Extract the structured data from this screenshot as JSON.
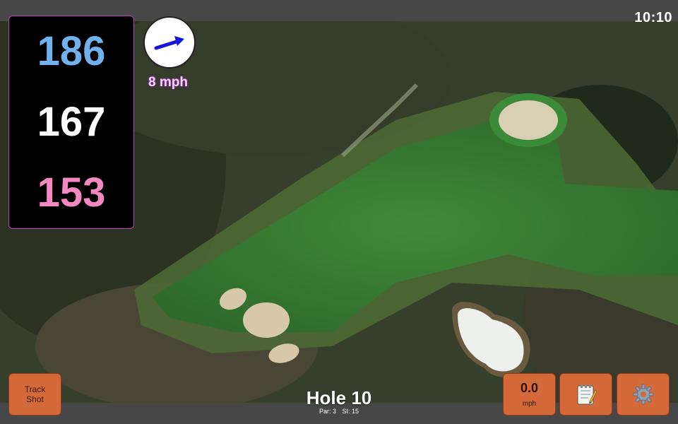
{
  "status": {
    "clock": "10:10"
  },
  "distances": {
    "back": "186",
    "middle": "167",
    "front": "153"
  },
  "wind": {
    "speed_label": "8 mph"
  },
  "buttons": {
    "track_shot_line1": "Track",
    "track_shot_line2": "Shot",
    "speed_value": "0.0",
    "speed_unit": "mph",
    "notes_icon": "notepad-icon",
    "settings_icon": "gear-icon"
  },
  "hole": {
    "title": "Hole 10",
    "par_label": "Par: 3",
    "si_label": "SI: 15"
  },
  "colors": {
    "back_distance": "#6fb2ee",
    "middle_distance": "#ffffff",
    "front_distance": "#f489c2",
    "button": "#d4693a"
  }
}
